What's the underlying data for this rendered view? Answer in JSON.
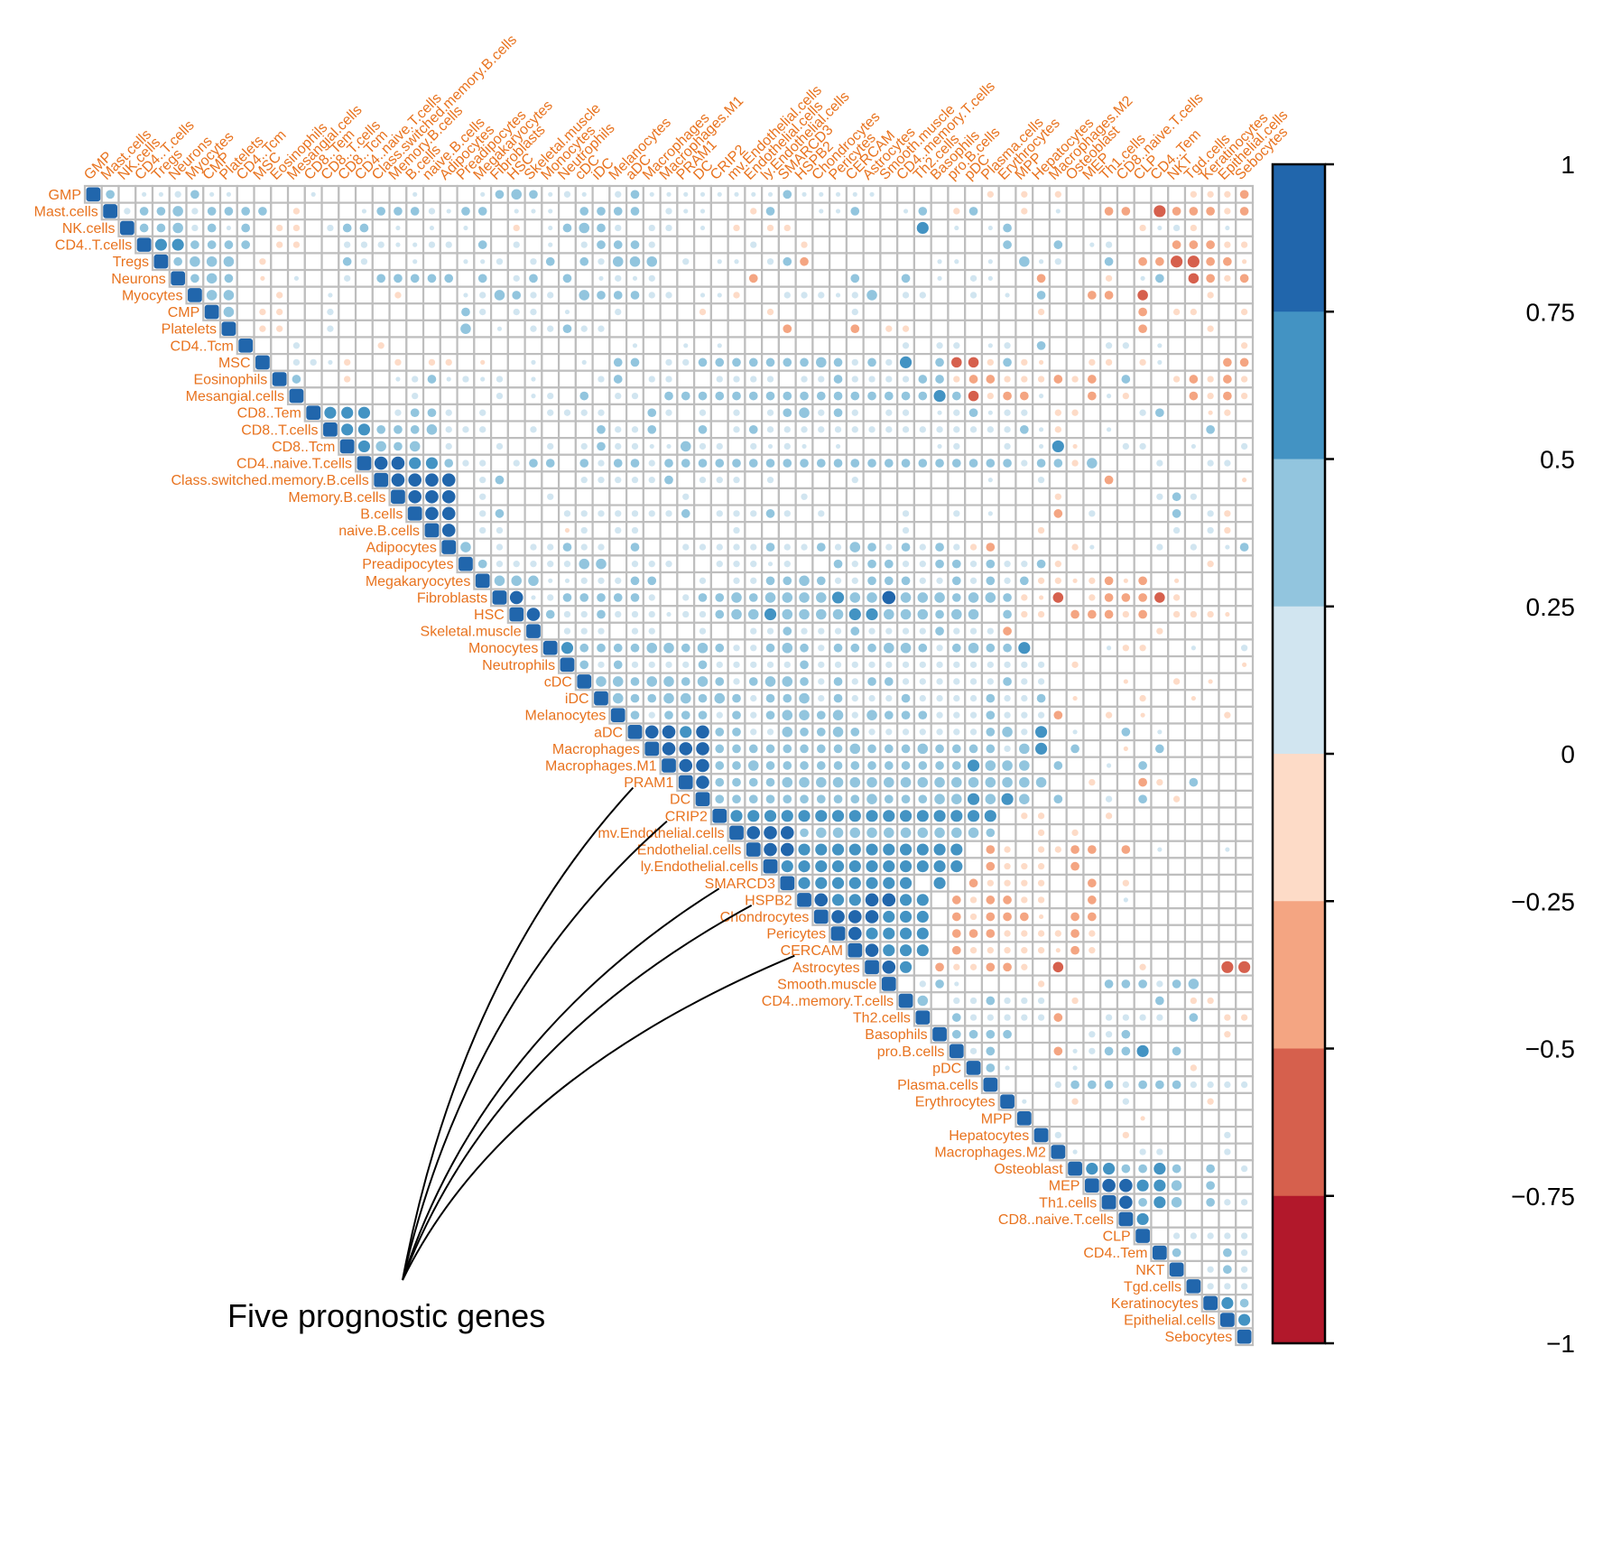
{
  "chart_data": {
    "type": "heatmap",
    "subtype": "correlation-matrix-upper-circles",
    "title": "",
    "variables": [
      "GMP",
      "Mast.cells",
      "NK.cells",
      "CD4..T.cells",
      "Tregs",
      "Neurons",
      "Myocytes",
      "CMP",
      "Platelets",
      "CD4..Tcm",
      "MSC",
      "Eosinophils",
      "Mesangial.cells",
      "CD8..Tem",
      "CD8..T.cells",
      "CD8..Tcm",
      "CD4..naive.T.cells",
      "Class.switched.memory.B.cells",
      "Memory.B.cells",
      "B.cells",
      "naive.B.cells",
      "Adipocytes",
      "Preadipocytes",
      "Megakaryocytes",
      "Fibroblasts",
      "HSC",
      "Skeletal.muscle",
      "Monocytes",
      "Neutrophils",
      "cDC",
      "iDC",
      "Melanocytes",
      "aDC",
      "Macrophages",
      "Macrophages.M1",
      "PRAM1",
      "DC",
      "CRIP2",
      "mv.Endothelial.cells",
      "Endothelial.cells",
      "ly.Endothelial.cells",
      "SMARCD3",
      "HSPB2",
      "Chondrocytes",
      "Pericytes",
      "CERCAM",
      "Astrocytes",
      "Smooth.muscle",
      "CD4..memory.T.cells",
      "Th2.cells",
      "Basophils",
      "pro.B.cells",
      "pDC",
      "Plasma.cells",
      "Erythrocytes",
      "MPP",
      "Hepatocytes",
      "Macrophages.M2",
      "Osteoblast",
      "MEP",
      "Th1.cells",
      "CD8..naive.T.cells",
      "CLP",
      "CD4..Tem",
      "NKT",
      "Tgd.cells",
      "Keratinocytes",
      "Epithelial.cells",
      "Sebocytes"
    ],
    "value_codes": {
      ".": 0,
      "a": 0.1,
      "b": 0.2,
      "c": 0.35,
      "d": 0.5,
      "e": 0.65,
      "f": 0.8,
      "D": 1,
      "A": -0.1,
      "B": -0.2,
      "C": -0.35,
      "E": -0.5,
      "F": -0.65
    },
    "upper_triangle_rows": [
      "Dc.aabcaa....a.....a...acdcaba.bcaaaaaaaacaaaaa......B.B.B.......BBBCBBBA..BB",
      "Dbccdbcccc.B...acccbacc.aaa.cccc.baa..Bc..aac..ac.Bc..B.a..CC.FCCCBC..CB",
      "Dccdbcac.BB.bcc.a.a.a..B.acdcb.bb.a.B.BB.......e.a.ac.......BabB.a....CB",
      "Deecccc.BB..bbbaabb.c.b.a.bcccb.....b..B...........c..c.ab...CCCBB.B..BCB",
      "Dcddd.B....cb..a..aab.bc.cbddd.b.aa.bcC.......aa.a.dab..c.CCFFCCAC..BFB",
      "Dcdc.A.a..b.ccccc.c.bc.c.abab.....C.....c..c.a.ba..C...B.ac.ECBCBBA..BFC",
      "Ddd..B..a...B...abdcbb.dcccbb.aaB..bbbabd.bb..b.a.c..CC.E...B..CCCBBB.CCC",
      "Dd.BB..b.......cb.bb.a..b....B...B....b..........B.....C.BB..BCCB..BCB",
      "D.BB..b.......d.a.bbcbb..........C...C.BB.............C...B..CCCBBB..CB",
      "D..b....B..............a..a.a..........b.bb.ab.c...bb.a....BB.b...B...",
      "D.bbaB..B.BB.A..a..a.cc.bbcccccccdcbcbe.cEEBcBA..BB.Ba...CCBCBA.a.a.B",
      "Dc..B..abcabab.a...bc.bb..bbbb.bbcbbbbccBCCBBBCBC.c..BCBCB..BC.BAb.b",
      "D......b....b.ab.c.bb.ccccccccccccccccecEBCCa..CaB...CBCBC..CBCA.BA",
      "Deee.bccb.b...bbbb..cb.b.b.bcdbcb.bb.abcabb.BB...bc..AB....CBCBB...BB",
      "Deecccdbbb..b...cbbc..c.bcbbbbbbbbbbbbbbbcaB..a.....c..A...CBBBB...BB",
      "Dedcd.b..b..b.bcbbaadbb.baba.a.....ab..b.aeA..bb..a..b..AcB.B.....CC",
      "Dffeecbb.bcc.cbccbcccccccccccccccccccccbccBd...b..bb..b..CBCB.aCAB.CB",
      "Dffff.bc....bbbbbc.bbb.b....b.......a..b...C.......ABA..A..AAC.A.A.A",
      "Dfff.b...b.......b......b..............B.....bcb...A..A.A...B....A.",
      "Dff.bc...bbbbbbbc.bbbcb.b....b..b.a...C.b....c.bB...B..CB.BC.AA...BA",
      "Df.bb...Ab.bb.....b.........b.......B.......b.bB...B..AB.A.B.....",
      "Dd.b.bbcbb.c..bbbbbcbbcbdcbcbcbBC....Ba...b.b.ac..CBCBB..BB..CB",
      "Dcbbbbbdd.bbb..bbbab..cbccbbccbcbbcB........B...a...BCBBA...B..CB",
      "Ddddaabbbcc..b.bbccdcbbcccbbcbcbcBBABCAC.A....ba.B..CCECCAC.BAA.CB",
      "Dfabcccccb.bccdcddddeddfdddcddcBAE.BCCCEB....aBA...CCFCCBCBCBCFC",
      "Dfcbbcbbbabbcddeddddeedddcdd.cBB.CCCBC.BBBA..aB..BCBCCBACCAC.CB",
      "D.bbb.bb..b..bbcbbbcbbbbcbbbC........B......A........AB....A.",
      "Deccccddcdcbbcdcbcccddcbcdcce....aBB..a..b..a....CCCCBCCB...CB",
      "Dcbcbbbbcbbbbbcbbbbbbbbbbbbbb.B.........A......BCCBBABBCC..BB",
      "Dddcddcdcbcddcbcbccbbbbbbcbb....A..B.A.....B.CCCCBCB.CA..BA",
      "Ddccddcdcbccdbcbbbcbbbbcbbc.A...B..A.....B.BCCCBCCBC.B.A..B",
      "DcbcccbcbcddcdbdcccbbbcbbbC..B.A....B.B..BCBCCBBBB...B.A",
      "Dffefccbbdccdcbbbbbbbcdbe.a..c.a..........CBBBCC...BCB.A",
      "Dfffccccccccdcccdccccbde.c..A.c..............CBBBCBB..CB.A",
      "Dffccdcccccccccccceddd.c..a.c.......b.a.....CCBBBBCC..A.BA",
      "Dfccccdddddddddddddddd..B..CB.c...........b.aCCCBCBCB....CB",
      "Dcccccccccdcccddeded.c..b.c.B.........CCCBCBCBB...CB",
      "Deeeeeeeeeeeeeeee.BB...B..........BBBCBBCB....BB",
      "Dfffcddddddddddc..B.B...........a...B.BBB...BB",
      "Dffeeeeeeeeee.CB.BBCC.C.a...a.CCCCCCCB.BC",
      "Deeeeeeeeeee.CBBB.C..........CCCCCCBB.BCC",
      "Deeeeeee.e.CBBBB..C.B.......CCCBCBCB..BCB",
      "Dfeeffee.CBCCBB..C.a.......CCCBCBCB..BCB",
      "Dfffeee.CBCCCA.CC...........CCFBCBCBABBCB",
      "Dfeeee.CCCBBBBCB............CCCBCBCB...CB",
      "Dfeee.CBBBBBACB.........CCCCBCBCB...CB",
      "Dfe.CBBCCB.E....B....FFFCCBCCBBCB.",
      "D.bca....B...cccbcd......",
      "Dd.bbcbbb.B....c.BB..BCB",
      "D.cbbbbbC..bbbb.c.BB..bB",
      "Dcccc....bbc.....B.....",
      "Dbc...Cabcce.c....bb..",
      "Dca...a......B...BB.",
      "D...bcccbcccbbbbcb",
      "Da..B..b....B.....",
      "D......A.......bb",
      "Db...B.....b.BB.",
      "Da...bb...b...",
      "Deeccec.c.bbc.",
      "Dffeed.c...b.",
      "Dfced.cbbcb.",
      "De........",
      "D.bbbbb",
      "Dc..cb",
      "D.bcb",
      "Dbbb",
      "Dec",
      "De",
      "D"
    ],
    "color_scale": {
      "breaks": [
        -1,
        -0.75,
        -0.5,
        -0.25,
        0,
        0.25,
        0.5,
        0.75,
        1
      ],
      "colors": [
        "#B2182B",
        "#D6604D",
        "#F4A582",
        "#FDDBC7",
        "#D1E5F0",
        "#92C5DE",
        "#4393C3",
        "#2166AC"
      ],
      "tick_labels": [
        "1",
        "0.75",
        "0.5",
        "0.25",
        "0",
        "−0.25",
        "−0.5",
        "−0.75",
        "−1"
      ]
    },
    "annotation": {
      "text": "Five prognostic genes",
      "targets": [
        "PRAM1",
        "CRIP2",
        "SMARCD3",
        "HSPB2",
        "CERCAM"
      ]
    },
    "label_color": "#E8731F",
    "grid_color": "#BEBEBE",
    "legend": "right",
    "grid": true
  }
}
